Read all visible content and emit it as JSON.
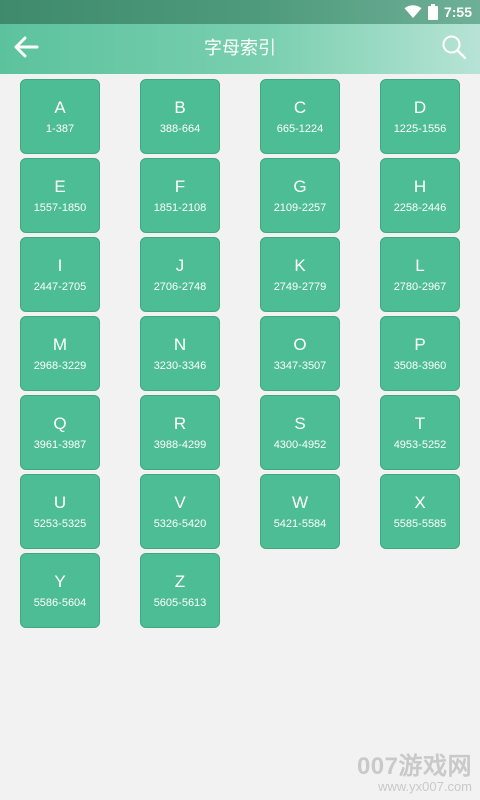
{
  "status_bar": {
    "time": "7:55",
    "icons": [
      "wifi-icon",
      "battery-icon"
    ],
    "background": "#4f9b7d"
  },
  "header": {
    "title": "字母索引",
    "back_icon": "arrow-left-icon",
    "search_icon": "search-icon",
    "background": "#5cc29e"
  },
  "tiles": [
    {
      "letter": "A",
      "range": "1-387"
    },
    {
      "letter": "B",
      "range": "388-664"
    },
    {
      "letter": "C",
      "range": "665-1224"
    },
    {
      "letter": "D",
      "range": "1225-1556"
    },
    {
      "letter": "E",
      "range": "1557-1850"
    },
    {
      "letter": "F",
      "range": "1851-2108"
    },
    {
      "letter": "G",
      "range": "2109-2257"
    },
    {
      "letter": "H",
      "range": "2258-2446"
    },
    {
      "letter": "I",
      "range": "2447-2705"
    },
    {
      "letter": "J",
      "range": "2706-2748"
    },
    {
      "letter": "K",
      "range": "2749-2779"
    },
    {
      "letter": "L",
      "range": "2780-2967"
    },
    {
      "letter": "M",
      "range": "2968-3229"
    },
    {
      "letter": "N",
      "range": "3230-3346"
    },
    {
      "letter": "O",
      "range": "3347-3507"
    },
    {
      "letter": "P",
      "range": "3508-3960"
    },
    {
      "letter": "Q",
      "range": "3961-3987"
    },
    {
      "letter": "R",
      "range": "3988-4299"
    },
    {
      "letter": "S",
      "range": "4300-4952"
    },
    {
      "letter": "T",
      "range": "4953-5252"
    },
    {
      "letter": "U",
      "range": "5253-5325"
    },
    {
      "letter": "V",
      "range": "5326-5420"
    },
    {
      "letter": "W",
      "range": "5421-5584"
    },
    {
      "letter": "X",
      "range": "5585-5585"
    },
    {
      "letter": "Y",
      "range": "5586-5604"
    },
    {
      "letter": "Z",
      "range": "5605-5613"
    }
  ],
  "colors": {
    "tile": "#4dbd96",
    "page_background": "#f2f2f2"
  },
  "watermark": {
    "main": "007游戏网",
    "url": "www.yx007.com"
  }
}
